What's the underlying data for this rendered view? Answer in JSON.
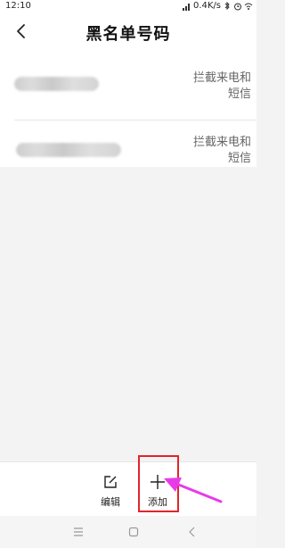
{
  "status_bar": {
    "time": "12:10",
    "network_speed": "0.4K/s"
  },
  "header": {
    "title": "黑名单号码",
    "back_icon": "back-chevron-icon"
  },
  "blacklist": {
    "items": [
      {
        "action_line1": "拦截来电和",
        "action_line2": "短信"
      },
      {
        "action_line1": "拦截来电和",
        "action_line2": "短信"
      }
    ]
  },
  "toolbar": {
    "edit_label": "编辑",
    "add_label": "添加",
    "edit_icon": "edit-icon",
    "add_icon": "plus-icon"
  },
  "annotation": {
    "highlight_color": "#e0252b",
    "arrow_color": "#e83be8"
  },
  "nav_bar": {
    "icons": [
      "menu-icon",
      "home-icon",
      "back-icon"
    ]
  }
}
